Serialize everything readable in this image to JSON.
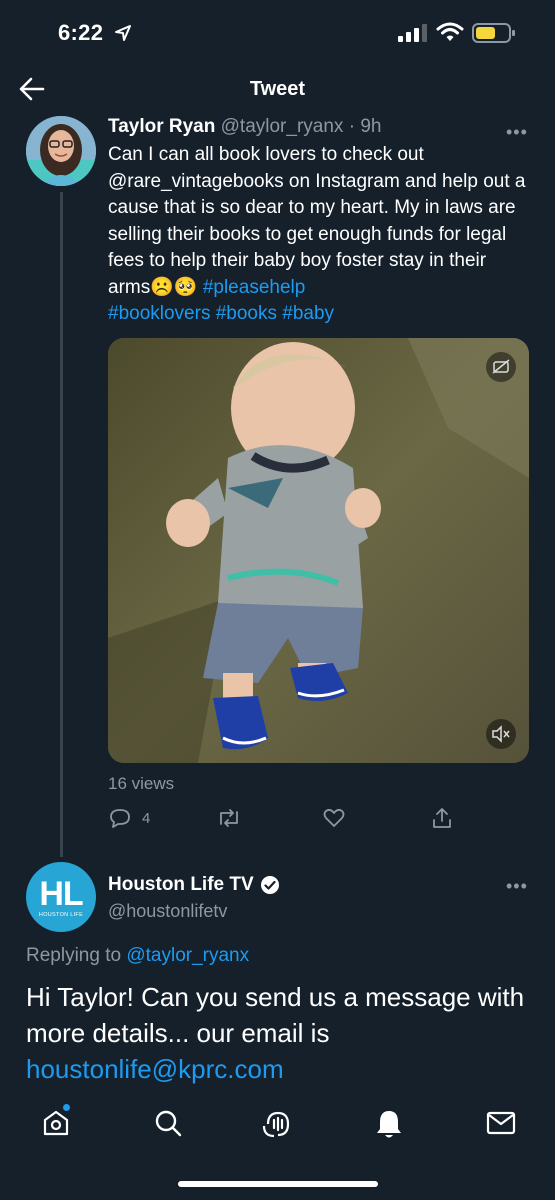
{
  "status_bar": {
    "time": "6:22"
  },
  "header": {
    "title": "Tweet"
  },
  "tweet": {
    "author_name": "Taylor Ryan",
    "author_handle": "@taylor_ryanx",
    "separator": "·",
    "time_ago": "9h",
    "text_main": "Can I can all book lovers to check out @rare_vintagebooks on Instagram and help out a cause that is so dear to my heart. My in laws are selling their books to get enough funds for legal fees to help their baby boy foster stay in their arms☹️🥺 ",
    "hashtag1": "#pleasehelp",
    "hashtags_line": "#booklovers #books #baby",
    "views": "16 views",
    "reply_count": "4"
  },
  "reply": {
    "author_name": "Houston Life TV",
    "author_handle": "@houstonlifetv",
    "avatar_letters": "HL",
    "avatar_subtext": "HOUSTON LIFE",
    "replying_prefix": "Replying to",
    "replying_to": "@taylor_ryanx",
    "text": "Hi Taylor! Can you send us a message with more details... our email is",
    "email": "houstonlife@kprc.com"
  },
  "colors": {
    "background": "#15202b",
    "accent": "#1d9bf0",
    "muted": "#8b98a5",
    "divider": "#38444d",
    "battery": "#f5d63d"
  },
  "tabbar": {
    "items": [
      "home-icon",
      "search-icon",
      "spaces-icon",
      "notifications-icon",
      "messages-icon"
    ]
  }
}
